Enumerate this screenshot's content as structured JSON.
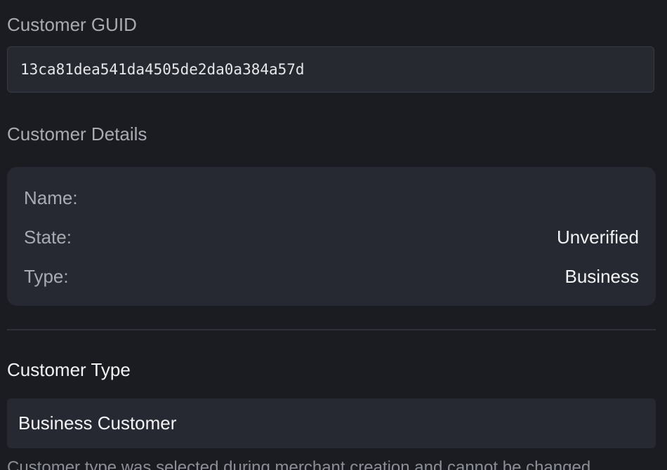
{
  "guid_section": {
    "label": "Customer GUID",
    "value": "13ca81dea541da4505de2da0a384a57d"
  },
  "details_section": {
    "label": "Customer Details",
    "rows": [
      {
        "key": "Name:",
        "value": ""
      },
      {
        "key": "State:",
        "value": "Unverified"
      },
      {
        "key": "Type:",
        "value": "Business"
      }
    ]
  },
  "customer_type_section": {
    "heading": "Customer Type",
    "selected_value": "Business Customer",
    "help_text": "Customer type was selected during merchant creation and cannot be changed."
  },
  "colors": {
    "background": "#1b1c21",
    "surface": "#272932",
    "muted_text": "#a9abb3",
    "primary_text": "#f2f3f5"
  }
}
